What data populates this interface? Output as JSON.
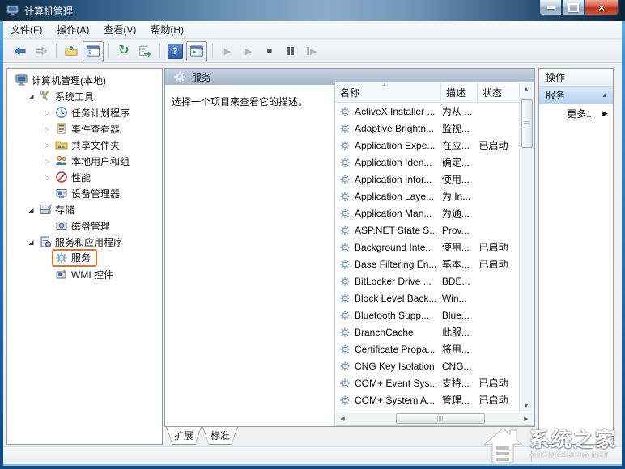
{
  "window": {
    "title": "计算机管理",
    "icon": "computer-icon",
    "controls": {
      "minimize": "minimize-button",
      "maximize": "maximize-button",
      "close": "close-button"
    }
  },
  "menu": {
    "items": [
      {
        "label": "文件(F)"
      },
      {
        "label": "操作(A)"
      },
      {
        "label": "查看(V)"
      },
      {
        "label": "帮助(H)"
      }
    ]
  },
  "toolbar": {
    "groups": [
      [
        "back-icon",
        "forward-icon"
      ],
      [
        "up-one-level-icon",
        "show-console-tree-icon"
      ],
      [
        "refresh-icon",
        "export-list-icon"
      ],
      [
        "help-icon",
        "show-action-pane-icon"
      ],
      [
        "start-service-icon",
        "resume-service-icon",
        "stop-service-icon",
        "pause-service-icon",
        "restart-service-icon"
      ]
    ]
  },
  "tree": {
    "items": [
      {
        "label": "计算机管理(本地)",
        "icon": "computer-icon",
        "level": 0,
        "expander": "none"
      },
      {
        "label": "系统工具",
        "icon": "tools-icon",
        "level": 1,
        "expander": "expanded"
      },
      {
        "label": "任务计划程序",
        "icon": "task-scheduler-icon",
        "level": 2,
        "expander": "collapsed"
      },
      {
        "label": "事件查看器",
        "icon": "event-viewer-icon",
        "level": 2,
        "expander": "collapsed"
      },
      {
        "label": "共享文件夹",
        "icon": "shared-folders-icon",
        "level": 2,
        "expander": "collapsed"
      },
      {
        "label": "本地用户和组",
        "icon": "local-users-icon",
        "level": 2,
        "expander": "collapsed"
      },
      {
        "label": "性能",
        "icon": "performance-icon",
        "level": 2,
        "expander": "collapsed"
      },
      {
        "label": "设备管理器",
        "icon": "device-manager-icon",
        "level": 2,
        "expander": "none"
      },
      {
        "label": "存储",
        "icon": "storage-icon",
        "level": 1,
        "expander": "expanded"
      },
      {
        "label": "磁盘管理",
        "icon": "disk-management-icon",
        "level": 2,
        "expander": "none"
      },
      {
        "label": "服务和应用程序",
        "icon": "services-apps-icon",
        "level": 1,
        "expander": "expanded"
      },
      {
        "label": "服务",
        "icon": "services-icon",
        "level": 2,
        "expander": "none",
        "highlighted": true
      },
      {
        "label": "WMI 控件",
        "icon": "wmi-icon",
        "level": 2,
        "expander": "none"
      }
    ]
  },
  "services_pane": {
    "header": "服务",
    "header_icon": "gear-icon",
    "description_hint": "选择一个项目来查看它的描述。",
    "columns": [
      "名称",
      "描述",
      "状态"
    ],
    "sort_column": "名称",
    "rows": [
      {
        "name": "ActiveX Installer ...",
        "description": "为从 ...",
        "status": ""
      },
      {
        "name": "Adaptive Brightn...",
        "description": "监视...",
        "status": ""
      },
      {
        "name": "Application Expe...",
        "description": "在应...",
        "status": "已启动"
      },
      {
        "name": "Application Iden...",
        "description": "确定...",
        "status": ""
      },
      {
        "name": "Application Infor...",
        "description": "使用...",
        "status": ""
      },
      {
        "name": "Application Laye...",
        "description": "为 In...",
        "status": ""
      },
      {
        "name": "Application Man...",
        "description": "为通...",
        "status": ""
      },
      {
        "name": "ASP.NET State S...",
        "description": "Prov...",
        "status": ""
      },
      {
        "name": "Background Inte...",
        "description": "使用...",
        "status": "已启动"
      },
      {
        "name": "Base Filtering En...",
        "description": "基本...",
        "status": "已启动"
      },
      {
        "name": "BitLocker Drive ...",
        "description": "BDE...",
        "status": ""
      },
      {
        "name": "Block Level Back...",
        "description": "Win...",
        "status": ""
      },
      {
        "name": "Bluetooth Supp...",
        "description": "Blue...",
        "status": ""
      },
      {
        "name": "BranchCache",
        "description": "此服...",
        "status": ""
      },
      {
        "name": "Certificate Propa...",
        "description": "将用...",
        "status": ""
      },
      {
        "name": "CNG Key Isolation",
        "description": "CNG...",
        "status": ""
      },
      {
        "name": "COM+ Event Sys...",
        "description": "支持...",
        "status": "已启动"
      },
      {
        "name": "COM+ System A...",
        "description": "管理...",
        "status": "已启动"
      }
    ]
  },
  "actions_pane": {
    "title": "操作",
    "section_label": "服务",
    "more_label": "更多..."
  },
  "tabs": {
    "items": [
      {
        "label": "扩展"
      },
      {
        "label": "标准"
      }
    ]
  },
  "watermark": {
    "title": "系统之家",
    "subtitle": "XITONGZHIJIA.NET"
  },
  "colors": {
    "annotation_orange": "#e2752e",
    "titlebar_blue": "#2d5a84",
    "aero_border_blue": "#2a7fc6",
    "action_section_blue": "#b7d2ec",
    "pane_header_gray_blue": "#a6b8cd"
  }
}
